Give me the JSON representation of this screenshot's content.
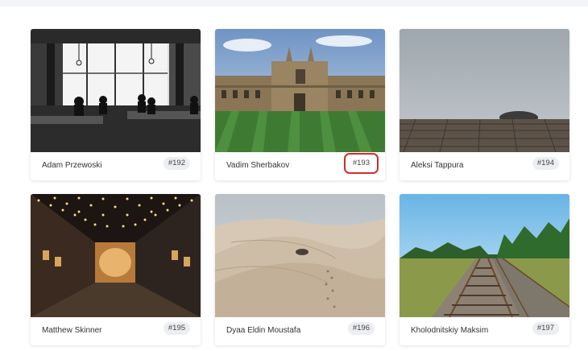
{
  "gallery": {
    "photos": [
      {
        "author": "Adam Przewoski",
        "id": "#192",
        "scene": "cafe-interior"
      },
      {
        "author": "Vadim Sherbakov",
        "id": "#193",
        "scene": "college-lawn",
        "highlighted": true
      },
      {
        "author": "Aleksi Tappura",
        "id": "#194",
        "scene": "foggy-pier"
      },
      {
        "author": "Matthew Skinner",
        "id": "#195",
        "scene": "night-alley-lights"
      },
      {
        "author": "Dyaa Eldin Moustafa",
        "id": "#196",
        "scene": "desert-dunes"
      },
      {
        "author": "Kholodnitskiy Maksim",
        "id": "#197",
        "scene": "railway-tracks"
      }
    ]
  },
  "colors": {
    "highlight": "#d62b2b",
    "badge_bg": "#eceef1",
    "page_bg": "#ffffff"
  }
}
